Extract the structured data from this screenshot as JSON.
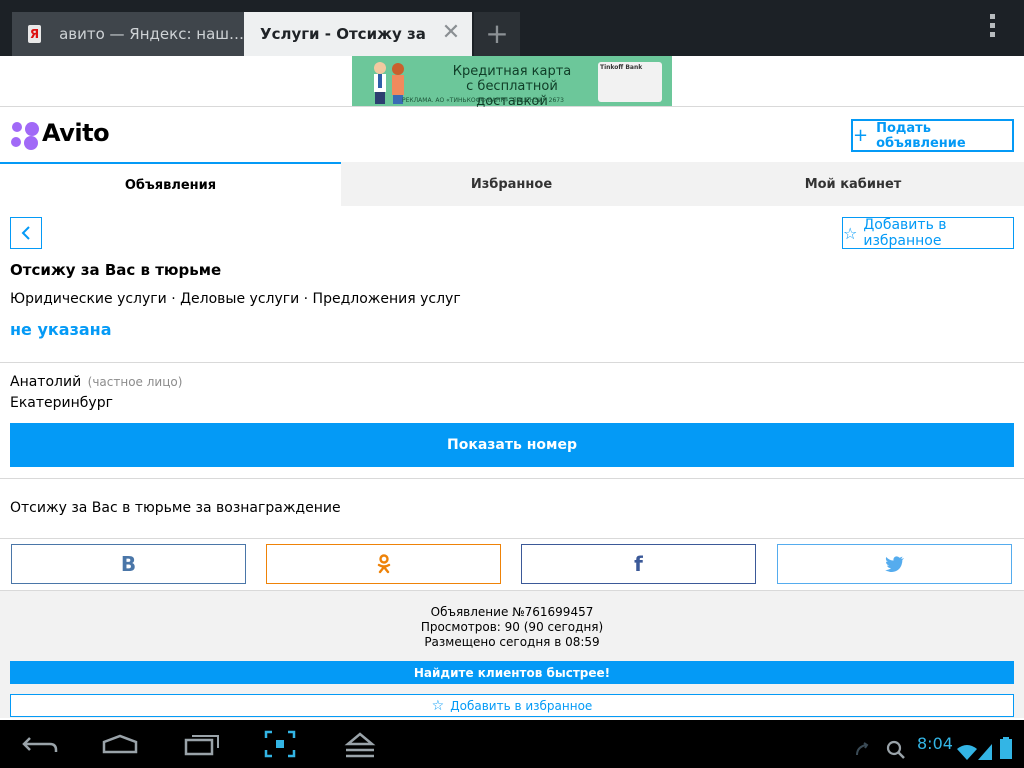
{
  "browser": {
    "tabs": [
      {
        "label": "авито — Яндекс: наш…",
        "favicon": "Я"
      },
      {
        "label": "Услуги - Отсижу за В…",
        "close": "✕"
      }
    ],
    "new_tab": "+"
  },
  "ad_banner": {
    "line1": "Кредитная карта",
    "line2": "с бесплатной доставкой",
    "disclaimer": "РЕКЛАМА. АО «ТИНЬКОФФ БАНК», ЛИЦЕНЗИЯ 2673",
    "card_brand": "Tinkoff Bank"
  },
  "site": {
    "logo": "Avito",
    "post_button": "Подать объявление",
    "post_plus": "+",
    "nav_tabs": [
      "Объявления",
      "Избранное",
      "Мой кабинет"
    ]
  },
  "listing": {
    "back": "‹",
    "add_favorite": "Добавить в избранное",
    "star": "☆",
    "title": "Отсижу за Вас в тюрьме",
    "breadcrumbs": "Юридические услуги · Деловые услуги · Предложения услуг",
    "price": "не указана",
    "seller_name": "Анатолий",
    "seller_type": "(частное лицо)",
    "city": "Екатеринбург",
    "show_phone": "Показать номер",
    "description": "Отсижу за Вас в тюрьме за вознаграждение"
  },
  "share": {
    "vk": "B",
    "ok": "ok-icon",
    "fb": "f",
    "tw": "twitter-icon"
  },
  "footer": {
    "ad_id": "Объявление №761699457",
    "views": "Просмотров: 90 (90 сегодня)",
    "posted": "Размещено сегодня в 08:59",
    "promote": "Найдите клиентов быстрее!",
    "add_favorite": "Добавить в избранное"
  },
  "system": {
    "time": "8:04"
  },
  "colors": {
    "accent": "#049af6",
    "logo_dots": [
      "#97cf26",
      "#a169f7",
      "#ff6163",
      "#00aaff"
    ]
  }
}
